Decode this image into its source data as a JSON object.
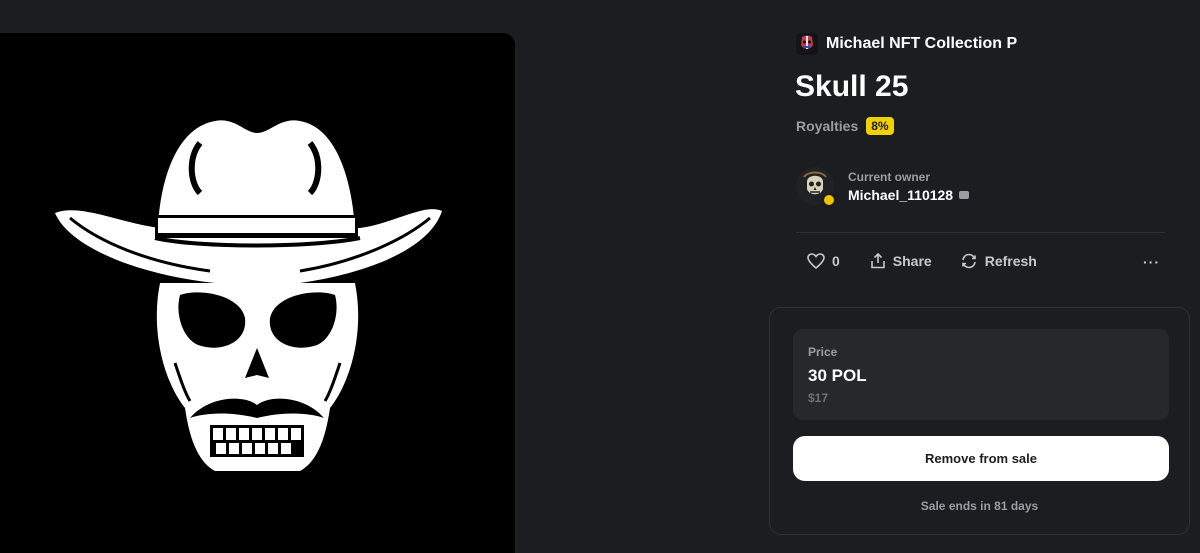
{
  "collection": {
    "name": "Michael NFT Collection P",
    "avatar_icon": "skull-helmet-icon"
  },
  "item": {
    "title": "Skull 25",
    "royalties_label": "Royalties",
    "royalties_value": "8%",
    "artwork": "cowboy-skull-artwork"
  },
  "owner": {
    "label": "Current owner",
    "name": "Michael_110128",
    "verified": true
  },
  "actions": {
    "like_count": "0",
    "share_label": "Share",
    "refresh_label": "Refresh",
    "more_label": "···"
  },
  "sale": {
    "price_label": "Price",
    "price_value": "30 POL",
    "price_fiat": "$17",
    "remove_label": "Remove from sale",
    "ends_text": "Sale ends in 81 days"
  },
  "colors": {
    "background": "#1b1d20",
    "accent_badge": "#f2d100",
    "card_border": "#2d3035"
  }
}
